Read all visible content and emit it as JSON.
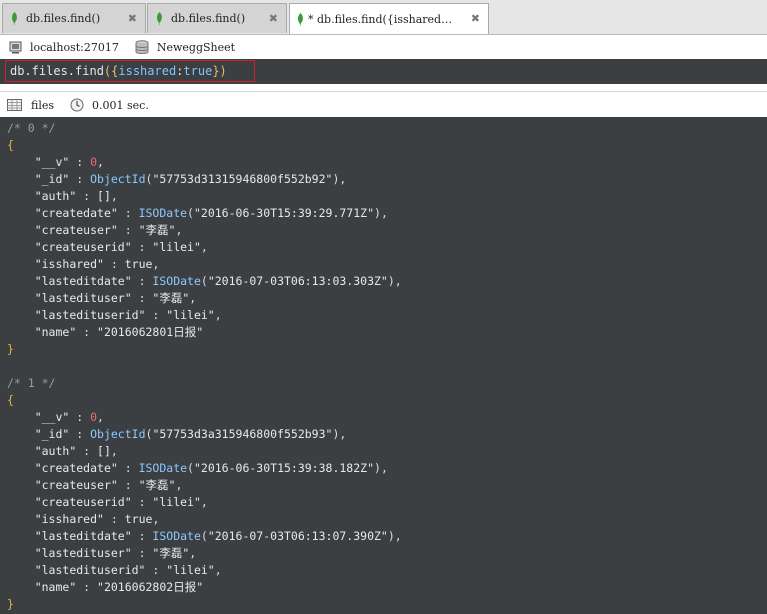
{
  "tabs": [
    {
      "label": "db.files.find()",
      "active": false
    },
    {
      "label": "db.files.find()",
      "active": false
    },
    {
      "label": "* db.files.find({isshared…",
      "active": true
    }
  ],
  "connection": {
    "host": "localhost:27017",
    "database": "NeweggSheet"
  },
  "query": {
    "prefix": "db.files.find",
    "open": "({",
    "key": "isshared",
    "sep": ":",
    "value": "true",
    "close": "})"
  },
  "result": {
    "collection": "files",
    "elapsed": "0.001 sec."
  },
  "documents": [
    {
      "comment": "/* 0 */",
      "fields": [
        {
          "key": "\"__v\"",
          "type": "num",
          "value": "0"
        },
        {
          "key": "\"_id\"",
          "type": "fn",
          "fn": "ObjectId",
          "value": "\"57753d31315946800f552b92\""
        },
        {
          "key": "\"auth\"",
          "type": "raw",
          "value": "[]"
        },
        {
          "key": "\"createdate\"",
          "type": "fn",
          "fn": "ISODate",
          "value": "\"2016-06-30T15:39:29.771Z\""
        },
        {
          "key": "\"createuser\"",
          "type": "str",
          "value": "\"李磊\""
        },
        {
          "key": "\"createuserid\"",
          "type": "str",
          "value": "\"lilei\""
        },
        {
          "key": "\"isshared\"",
          "type": "bool",
          "value": "true"
        },
        {
          "key": "\"lasteditdate\"",
          "type": "fn",
          "fn": "ISODate",
          "value": "\"2016-07-03T06:13:03.303Z\""
        },
        {
          "key": "\"lastedituser\"",
          "type": "str",
          "value": "\"李磊\""
        },
        {
          "key": "\"lastedituserid\"",
          "type": "str",
          "value": "\"lilei\""
        },
        {
          "key": "\"name\"",
          "type": "str",
          "value": "\"2016062801日报\"",
          "last": true
        }
      ]
    },
    {
      "comment": "/* 1 */",
      "fields": [
        {
          "key": "\"__v\"",
          "type": "num",
          "value": "0"
        },
        {
          "key": "\"_id\"",
          "type": "fn",
          "fn": "ObjectId",
          "value": "\"57753d3a315946800f552b93\""
        },
        {
          "key": "\"auth\"",
          "type": "raw",
          "value": "[]"
        },
        {
          "key": "\"createdate\"",
          "type": "fn",
          "fn": "ISODate",
          "value": "\"2016-06-30T15:39:38.182Z\""
        },
        {
          "key": "\"createuser\"",
          "type": "str",
          "value": "\"李磊\""
        },
        {
          "key": "\"createuserid\"",
          "type": "str",
          "value": "\"lilei\""
        },
        {
          "key": "\"isshared\"",
          "type": "bool",
          "value": "true"
        },
        {
          "key": "\"lasteditdate\"",
          "type": "fn",
          "fn": "ISODate",
          "value": "\"2016-07-03T06:13:07.390Z\""
        },
        {
          "key": "\"lastedituser\"",
          "type": "str",
          "value": "\"李磊\""
        },
        {
          "key": "\"lastedituserid\"",
          "type": "str",
          "value": "\"lilei\""
        },
        {
          "key": "\"name\"",
          "type": "str",
          "value": "\"2016062802日报\"",
          "last": true
        }
      ]
    }
  ],
  "colors": {
    "editor_bg": "#3b3f42",
    "query_border": "#d21f2c",
    "brace": "#e8b33a",
    "number": "#e87070",
    "function": "#8cc8ff",
    "leaf_green": "#3d9b35"
  },
  "icons": {
    "tab": "mongodb-leaf-icon",
    "close": "close-icon",
    "server": "server-icon",
    "database": "database-icon",
    "collection": "table-grid-icon",
    "time": "clock-icon"
  }
}
